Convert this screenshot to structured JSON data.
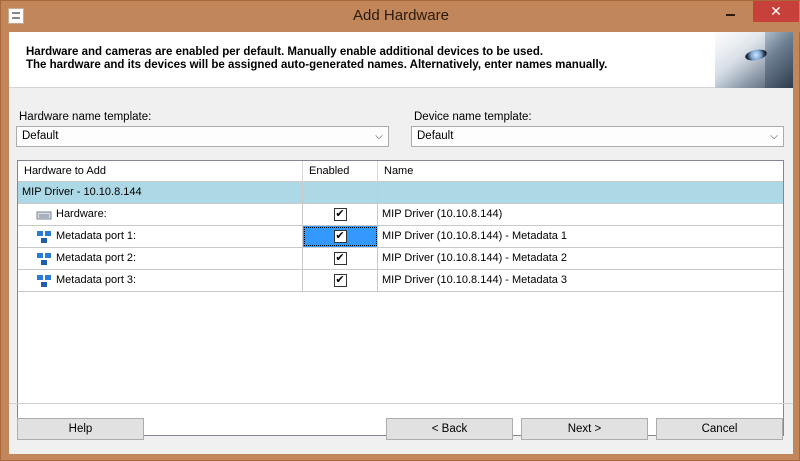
{
  "window": {
    "title": "Add Hardware",
    "close_glyph": "✕"
  },
  "banner": {
    "line1": "Hardware and cameras are enabled per default. Manually enable additional devices to be used.",
    "line2": "The hardware and its devices will be assigned auto-generated names. Alternatively, enter names manually."
  },
  "templates": {
    "hardware_label": "Hardware name template:",
    "hardware_value": "Default",
    "device_label": "Device name template:",
    "device_value": "Default"
  },
  "grid": {
    "headers": [
      "Hardware to Add",
      "Enabled",
      "Name"
    ],
    "group": {
      "label": "MIP Driver - 10.10.8.144"
    },
    "rows": [
      {
        "label": "Hardware:",
        "icon": "hardware-icon",
        "enabled": true,
        "name": "MIP Driver (10.10.8.144)",
        "selected": false
      },
      {
        "label": "Metadata port 1:",
        "icon": "metadata-icon",
        "enabled": true,
        "name": "MIP Driver (10.10.8.144) - Metadata 1",
        "selected": true
      },
      {
        "label": "Metadata port 2:",
        "icon": "metadata-icon",
        "enabled": true,
        "name": "MIP Driver (10.10.8.144) - Metadata 2",
        "selected": false
      },
      {
        "label": "Metadata port 3:",
        "icon": "metadata-icon",
        "enabled": true,
        "name": "MIP Driver (10.10.8.144) - Metadata 3",
        "selected": false
      }
    ],
    "check_glyph": "✔"
  },
  "buttons": {
    "help": "Help",
    "back": "< Back",
    "next": "Next >",
    "cancel": "Cancel"
  },
  "colors": {
    "titlebar": "#c1865a",
    "close": "#c7403a",
    "group_row": "#add8e6",
    "selection": "#3399ff"
  }
}
